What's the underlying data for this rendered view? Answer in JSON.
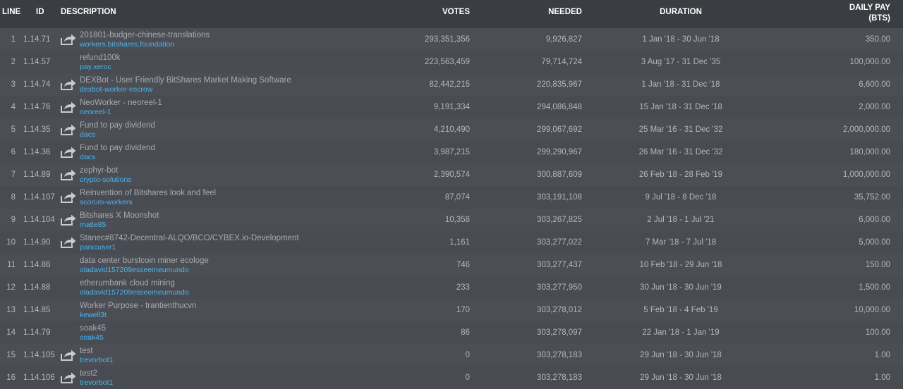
{
  "columns": {
    "line": "LINE",
    "id": "ID",
    "description": "DESCRIPTION",
    "votes": "VOTES",
    "needed": "NEEDED",
    "duration": "DURATION",
    "daily_pay_line1": "DAILY PAY",
    "daily_pay_line2": "(BTS)"
  },
  "colors": {
    "header_bg": "#3a3d42",
    "row_bg": "#494c52",
    "account_link": "#4db3ee",
    "text": "#b4b7bb"
  },
  "rows": [
    {
      "line": "1",
      "id": "1.14.71",
      "name": "201801-budger-chinese-translations",
      "account": "workers.bitshares.foundation",
      "votes": "293,351,356",
      "needed": "9,926,827",
      "duration": "1 Jan '18 - 30 Jun '18",
      "pay": "350.00",
      "icon": "share-icon"
    },
    {
      "line": "2",
      "id": "1.14.57",
      "name": "refund100k",
      "account": "pay.xeroc",
      "votes": "223,563,459",
      "needed": "79,714,724",
      "duration": "3 Aug '17 - 31 Dec '35",
      "pay": "100,000.00",
      "icon": ""
    },
    {
      "line": "3",
      "id": "1.14.74",
      "name": "DEXBot - User Friendly BitShares Market Making Software",
      "account": "dexbot-worker-escrow",
      "votes": "82,442,215",
      "needed": "220,835,967",
      "duration": "1 Jan '18 - 31 Dec '18",
      "pay": "6,600.00",
      "icon": "share-icon"
    },
    {
      "line": "4",
      "id": "1.14.76",
      "name": "NeoWorker - neoreel-1",
      "account": "neoreel-1",
      "votes": "9,191,334",
      "needed": "294,086,848",
      "duration": "15 Jan '18 - 31 Dec '18",
      "pay": "2,000.00",
      "icon": "share-icon"
    },
    {
      "line": "5",
      "id": "1.14.35",
      "name": "Fund to pay dividend",
      "account": "dacs",
      "votes": "4,210,490",
      "needed": "299,067,692",
      "duration": "25 Mar '16 - 31 Dec '32",
      "pay": "2,000,000.00",
      "icon": "share-icon"
    },
    {
      "line": "6",
      "id": "1.14.36",
      "name": "Fund to pay dividend",
      "account": "dacs",
      "votes": "3,987,215",
      "needed": "299,290,967",
      "duration": "26 Mar '16 - 31 Dec '32",
      "pay": "180,000.00",
      "icon": "share-icon"
    },
    {
      "line": "7",
      "id": "1.14.89",
      "name": "zephyr-bot",
      "account": "crypto-solutions",
      "votes": "2,390,574",
      "needed": "300,887,609",
      "duration": "26 Feb '18 - 28 Feb '19",
      "pay": "1,000,000.00",
      "icon": "share-icon"
    },
    {
      "line": "8",
      "id": "1.14.107",
      "name": "Reinvention of Bitshares look and feel",
      "account": "scorum-workers",
      "votes": "87,074",
      "needed": "303,191,108",
      "duration": "9 Jul '18 - 8 Dec '18",
      "pay": "35,752.00",
      "icon": "share-icon"
    },
    {
      "line": "9",
      "id": "1.14.104",
      "name": "Bitshares X Moonshot",
      "account": "matle85",
      "votes": "10,358",
      "needed": "303,267,825",
      "duration": "2 Jul '18 - 1 Jul '21",
      "pay": "6,000.00",
      "icon": "share-icon"
    },
    {
      "line": "10",
      "id": "1.14.90",
      "name": "Stanec#8742-Decentral-ALQO/BCO/CYBEX.io-Development",
      "account": "panicuser1",
      "votes": "1,161",
      "needed": "303,277,022",
      "duration": "7 Mar '18 - 7 Jul '18",
      "pay": "5,000.00",
      "icon": "share-icon"
    },
    {
      "line": "11",
      "id": "1.14.86",
      "name": "data center burstcoin miner ecologe",
      "account": "oladavid157209esseemeumundo",
      "votes": "746",
      "needed": "303,277,437",
      "duration": "10 Feb '18 - 29 Jun '18",
      "pay": "150.00",
      "icon": ""
    },
    {
      "line": "12",
      "id": "1.14.88",
      "name": "etherumbank cloud mining",
      "account": "oladavid157209esseemeumundo",
      "votes": "233",
      "needed": "303,277,950",
      "duration": "30 Jun '18 - 30 Jun '19",
      "pay": "1,500.00",
      "icon": ""
    },
    {
      "line": "13",
      "id": "1.14.85",
      "name": "Worker Purpose - trantienthucvn",
      "account": "kewell3t",
      "votes": "170",
      "needed": "303,278,012",
      "duration": "5 Feb '18 - 4 Feb '19",
      "pay": "10,000.00",
      "icon": ""
    },
    {
      "line": "14",
      "id": "1.14.79",
      "name": "soak45",
      "account": "soak45",
      "votes": "86",
      "needed": "303,278,097",
      "duration": "22 Jan '18 - 1 Jan '19",
      "pay": "100.00",
      "icon": ""
    },
    {
      "line": "15",
      "id": "1.14.105",
      "name": "test",
      "account": "trevorbot1",
      "votes": "0",
      "needed": "303,278,183",
      "duration": "29 Jun '18 - 30 Jun '18",
      "pay": "1.00",
      "icon": "share-icon"
    },
    {
      "line": "16",
      "id": "1.14.106",
      "name": "test2",
      "account": "trevorbot1",
      "votes": "0",
      "needed": "303,278,183",
      "duration": "29 Jun '18 - 30 Jun '18",
      "pay": "1.00",
      "icon": "share-icon"
    }
  ]
}
